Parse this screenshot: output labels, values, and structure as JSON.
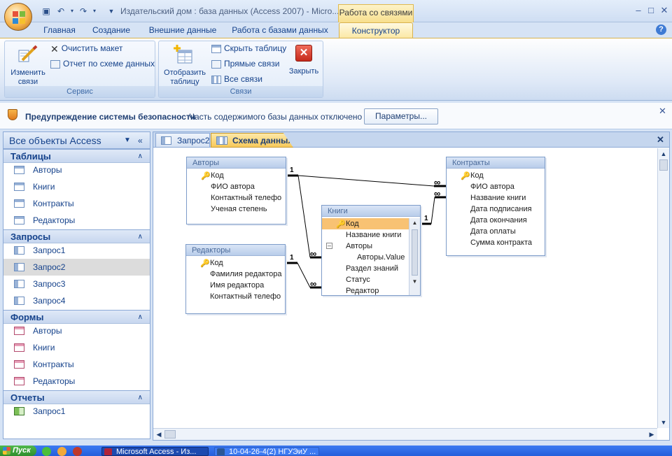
{
  "window": {
    "title": "Издательский дом : база данных (Access 2007) - Micro...",
    "context_tab_title": "Работа со связями"
  },
  "ribbon": {
    "tabs": [
      "Главная",
      "Создание",
      "Внешние данные",
      "Работа с базами данных",
      "Конструктор"
    ],
    "groups": {
      "service": {
        "label": "Сервис",
        "edit_relations": "Изменить связи",
        "clear_layout": "Очистить макет",
        "relations_report": "Отчет по схеме данных"
      },
      "relations": {
        "label": "Связи",
        "show_table": "Отобразить таблицу",
        "hide_table": "Скрыть таблицу",
        "direct_relations": "Прямые связи",
        "all_relations": "Все связи",
        "close": "Закрыть"
      }
    }
  },
  "security_bar": {
    "title": "Предупреждение системы безопасности",
    "message": "Часть содержимого базы данных отключено",
    "button": "Параметры..."
  },
  "nav": {
    "header": "Все объекты Access",
    "sections": [
      {
        "title": "Таблицы",
        "items": [
          "Авторы",
          "Книги",
          "Контракты",
          "Редакторы"
        ]
      },
      {
        "title": "Запросы",
        "items": [
          "Запрос1",
          "Запрос2",
          "Запрос3",
          "Запрос4"
        ],
        "selected": 1
      },
      {
        "title": "Формы",
        "items": [
          "Авторы",
          "Книги",
          "Контракты",
          "Редакторы"
        ]
      },
      {
        "title": "Отчеты",
        "items": [
          "Запрос1"
        ]
      }
    ]
  },
  "doc_tabs": [
    "Запрос2",
    "Схема данных"
  ],
  "schema": {
    "tables": {
      "authors": {
        "title": "Авторы",
        "fields": [
          "Код",
          "ФИО автора",
          "Контактный телефо",
          "Ученая степень"
        ]
      },
      "editors": {
        "title": "Редакторы",
        "fields": [
          "Код",
          "Фамилия редактора",
          "Имя редактора",
          "Контактный телефо"
        ]
      },
      "books": {
        "title": "Книги",
        "fields": [
          "Код",
          "Название книги",
          "Авторы",
          "Авторы.Value",
          "Раздел знаний",
          "Статус",
          "Редактор"
        ]
      },
      "contracts": {
        "title": "Контракты",
        "fields": [
          "Код",
          "ФИО автора",
          "Название книги",
          "Дата подписания",
          "Дата окончания",
          "Дата оплаты",
          "Сумма контракта"
        ]
      }
    },
    "rel_one": "1",
    "rel_many": "∞"
  },
  "taskbar": {
    "start": "Пуск",
    "buttons": [
      "Microsoft Access - Из...",
      "10-04-26-4(2) НГУЭиУ ..."
    ]
  }
}
